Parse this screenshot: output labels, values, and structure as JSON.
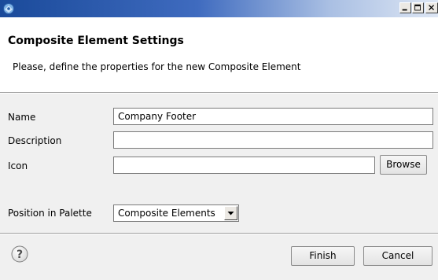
{
  "window": {
    "title": "",
    "minimize_icon": "minimize-icon",
    "maximize_icon": "maximize-icon",
    "close_icon": "close-icon"
  },
  "header": {
    "title": "Composite Element Settings",
    "description": "Please, define the properties for the new Composite Element"
  },
  "form": {
    "name_label": "Name",
    "name_value": "Company Footer",
    "description_label": "Description",
    "description_value": "",
    "icon_label": "Icon",
    "icon_value": "",
    "browse_label": "Browse",
    "position_label": "Position in Palette",
    "position_value": "Composite Elements"
  },
  "footer": {
    "help_icon": "help-icon",
    "finish_label": "Finish",
    "cancel_label": "Cancel"
  }
}
